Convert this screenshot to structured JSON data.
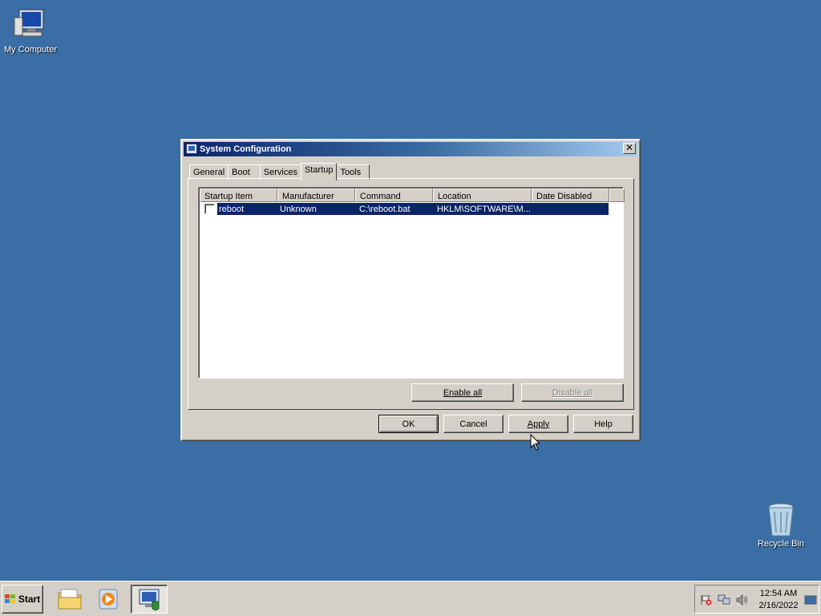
{
  "desktop": {
    "icons": [
      {
        "label": "My Computer"
      },
      {
        "label": "Recycle Bin"
      }
    ],
    "background_color": "#3a6ea5"
  },
  "window": {
    "title": "System Configuration",
    "close_glyph": "✕",
    "tabs": [
      {
        "label": "General"
      },
      {
        "label": "Boot"
      },
      {
        "label": "Services"
      },
      {
        "label": "Startup"
      },
      {
        "label": "Tools"
      }
    ],
    "active_tab": "Startup",
    "startup_list": {
      "columns": [
        "Startup Item",
        "Manufacturer",
        "Command",
        "Location",
        "Date Disabled"
      ],
      "rows": [
        {
          "checked": false,
          "startup_item": "reboot",
          "manufacturer": "Unknown",
          "command": "C:\\reboot.bat",
          "location": "HKLM\\SOFTWARE\\M...",
          "date_disabled": "",
          "selected": true
        }
      ]
    },
    "buttons": {
      "enable_all": "Enable all",
      "disable_all": "Disable all",
      "ok": "OK",
      "cancel": "Cancel",
      "apply": "Apply",
      "help": "Help"
    },
    "accent_color": "#0a246a"
  },
  "taskbar": {
    "start_label": "Start",
    "pinned": [
      {
        "name": "file-explorer-icon"
      },
      {
        "name": "media-player-icon"
      },
      {
        "name": "system-configuration-icon",
        "active": true
      }
    ],
    "clock": {
      "time": "12:54 AM",
      "date": "2/16/2022"
    }
  }
}
